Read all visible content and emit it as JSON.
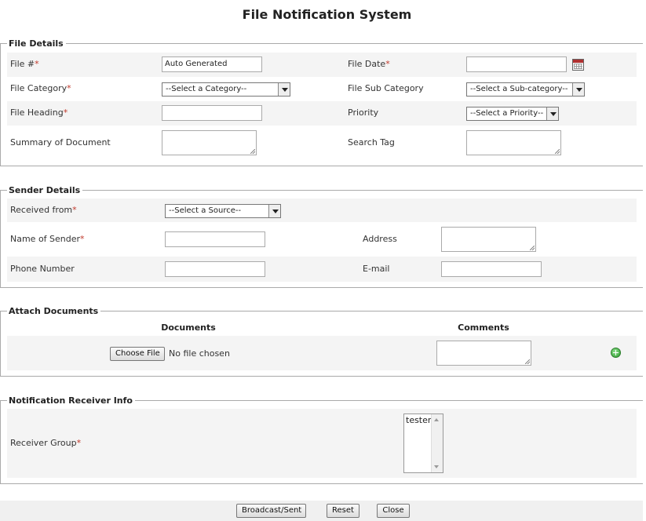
{
  "page": {
    "title": "File Notification System"
  },
  "file_details": {
    "legend": "File Details",
    "file_no_label": "File #",
    "file_no_value": "Auto Generated",
    "file_date_label": "File Date",
    "file_category_label": "File Category",
    "file_category_value": "--Select a Category--",
    "file_sub_category_label": "File Sub Category",
    "file_sub_category_value": "--Select a Sub-category--",
    "file_heading_label": "File Heading",
    "priority_label": "Priority",
    "priority_value": "--Select a Priority--",
    "summary_label": "Summary of Document",
    "search_tag_label": "Search Tag"
  },
  "sender_details": {
    "legend": "Sender Details",
    "received_from_label": "Received from",
    "received_from_value": "--Select a Source--",
    "sender_name_label": "Name of Sender",
    "address_label": "Address",
    "phone_label": "Phone Number",
    "email_label": "E-mail"
  },
  "attach": {
    "legend": "Attach Documents",
    "col_documents": "Documents",
    "col_comments": "Comments",
    "choose_file_label": "Choose File",
    "no_file_text": "No file chosen"
  },
  "receiver": {
    "legend": "Notification Receiver Info",
    "group_label": "Receiver Group",
    "options": [
      "tester"
    ]
  },
  "required_mark": "*",
  "buttons": {
    "broadcast": "Broadcast/Sent",
    "reset": "Reset",
    "close": "Close"
  },
  "colors": {
    "required": "#c0392b",
    "band": "#f4f4f4",
    "add_icon": "#2c9a2c"
  }
}
